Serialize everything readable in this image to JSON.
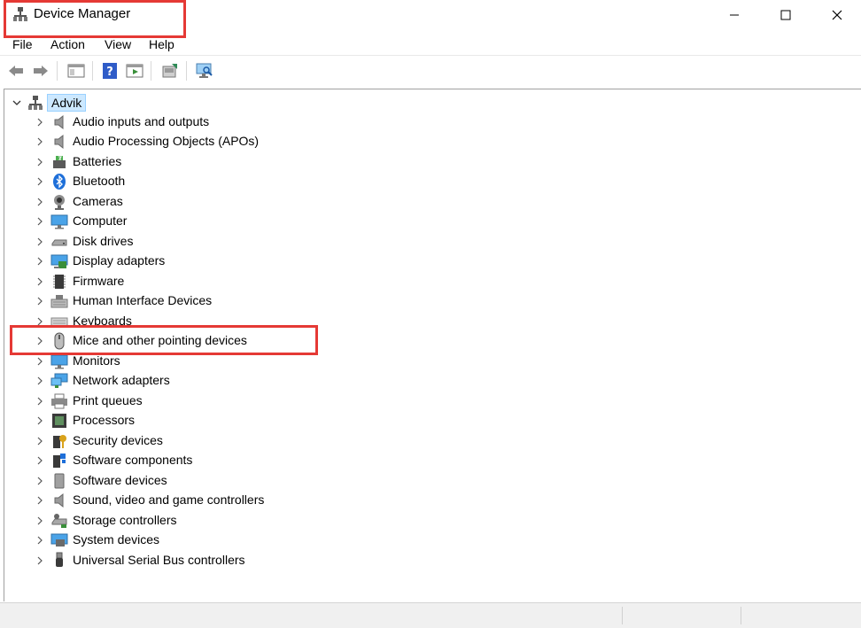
{
  "window": {
    "title": "Device Manager",
    "controls": [
      "minimize",
      "maximize",
      "close"
    ]
  },
  "menu": [
    {
      "label": "File"
    },
    {
      "label": "Action"
    },
    {
      "label": "View"
    },
    {
      "label": "Help"
    }
  ],
  "toolbar": {
    "buttons": [
      "back-arrow-icon",
      "forward-arrow-icon",
      "show-hide-console-tree-icon",
      "help-icon",
      "properties-icon",
      "update-driver-icon",
      "scan-hardware-icon"
    ]
  },
  "tree": {
    "root": {
      "label": "Advik",
      "expanded": true,
      "selected": true
    },
    "items": [
      {
        "label": "Audio inputs and outputs",
        "icon": "speaker-icon"
      },
      {
        "label": "Audio Processing Objects (APOs)",
        "icon": "speaker-icon"
      },
      {
        "label": "Batteries",
        "icon": "battery-icon"
      },
      {
        "label": "Bluetooth",
        "icon": "bluetooth-icon"
      },
      {
        "label": "Cameras",
        "icon": "camera-icon"
      },
      {
        "label": "Computer",
        "icon": "monitor-icon"
      },
      {
        "label": "Disk drives",
        "icon": "disk-drive-icon"
      },
      {
        "label": "Display adapters",
        "icon": "display-adapter-icon"
      },
      {
        "label": "Firmware",
        "icon": "firmware-chip-icon"
      },
      {
        "label": "Human Interface Devices",
        "icon": "hid-icon"
      },
      {
        "label": "Keyboards",
        "icon": "keyboard-icon"
      },
      {
        "label": "Mice and other pointing devices",
        "icon": "mouse-icon"
      },
      {
        "label": "Monitors",
        "icon": "monitor-icon"
      },
      {
        "label": "Network adapters",
        "icon": "network-adapter-icon"
      },
      {
        "label": "Print queues",
        "icon": "printer-icon"
      },
      {
        "label": "Processors",
        "icon": "processor-icon"
      },
      {
        "label": "Security devices",
        "icon": "security-device-icon"
      },
      {
        "label": "Software components",
        "icon": "software-component-icon"
      },
      {
        "label": "Software devices",
        "icon": "software-device-icon"
      },
      {
        "label": "Sound, video and game controllers",
        "icon": "speaker-icon"
      },
      {
        "label": "Storage controllers",
        "icon": "storage-controller-icon"
      },
      {
        "label": "System devices",
        "icon": "system-device-icon"
      },
      {
        "label": "Universal Serial Bus controllers",
        "icon": "usb-icon"
      }
    ]
  },
  "annotations": {
    "highlight_color": "#e53935",
    "highlighted": [
      "window.title",
      "Mice and other pointing devices"
    ]
  }
}
